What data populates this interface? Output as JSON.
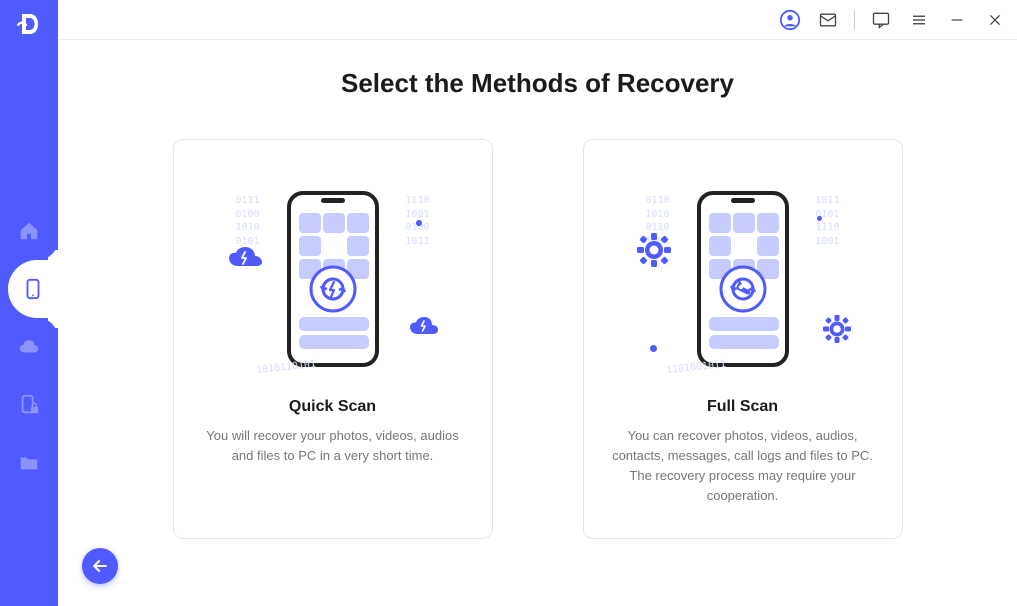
{
  "colors": {
    "accent": "#4f5bff",
    "light": "#c7ccff"
  },
  "titlebar": {
    "account_icon": "account-icon",
    "mail_icon": "mail-icon",
    "feedback_icon": "feedback-icon",
    "menu_icon": "menu-icon",
    "minimize_icon": "minimize-icon",
    "close_icon": "close-icon"
  },
  "sidebar": {
    "logo": "D",
    "items": [
      {
        "id": "home",
        "icon": "home-icon"
      },
      {
        "id": "phone",
        "icon": "phone-icon",
        "active": true
      },
      {
        "id": "cloud",
        "icon": "cloud-icon"
      },
      {
        "id": "secure-phone",
        "icon": "phone-lock-icon"
      },
      {
        "id": "folder",
        "icon": "folder-icon"
      }
    ]
  },
  "page": {
    "title": "Select the Methods of Recovery"
  },
  "cards": [
    {
      "id": "quick-scan",
      "title": "Quick Scan",
      "desc": "You will recover your photos, videos, audios and files to PC in a very short time.",
      "illus": "quick"
    },
    {
      "id": "full-scan",
      "title": "Full Scan",
      "desc": "You can recover photos, videos, audios, contacts, messages, call logs and files to PC. The recovery process may require your cooperation.",
      "illus": "full"
    }
  ],
  "back": {
    "label": "Back"
  }
}
